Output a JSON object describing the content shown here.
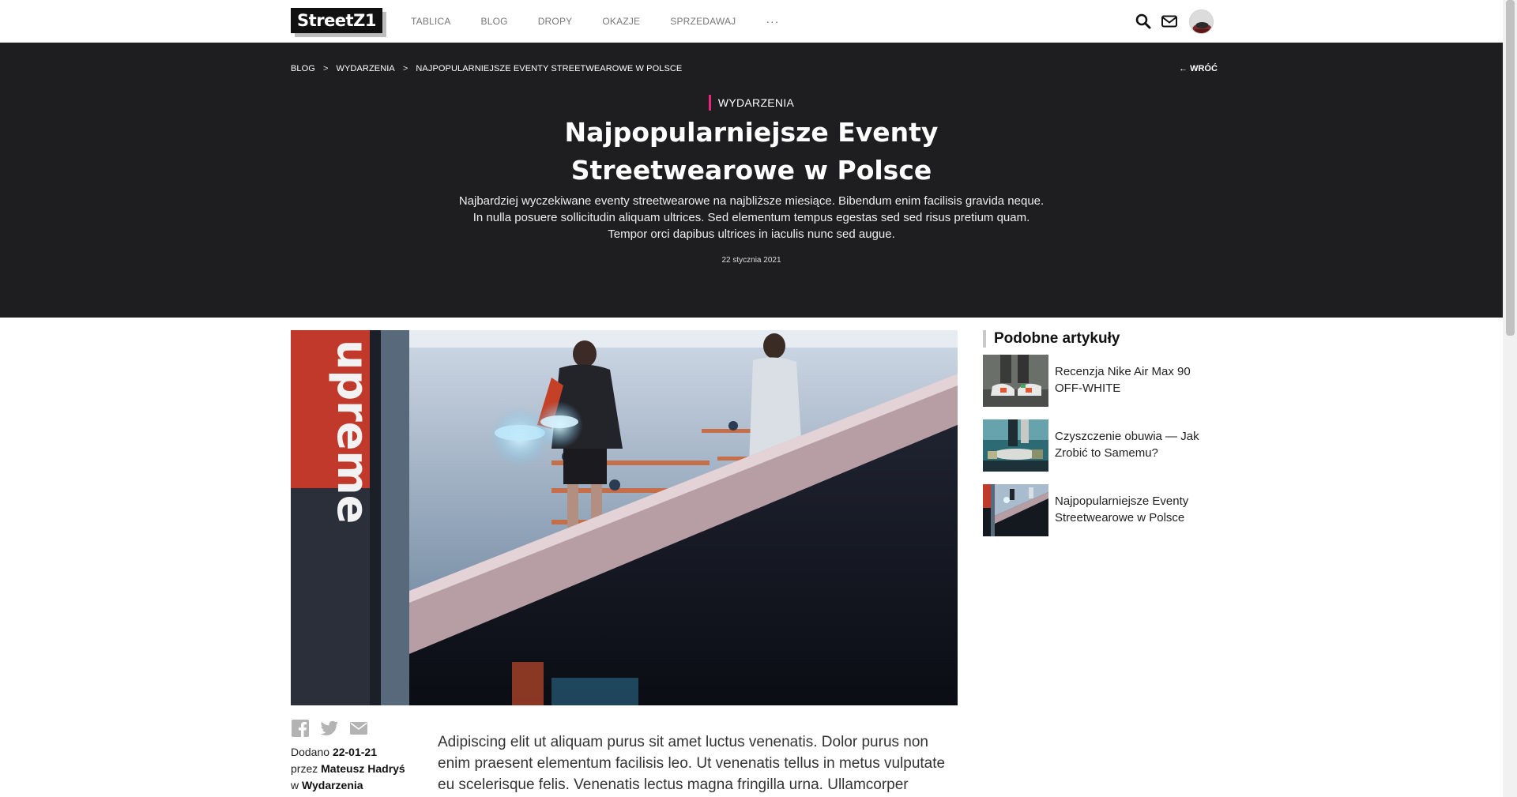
{
  "brand": {
    "logo_text": "StreetZ1"
  },
  "nav": {
    "items": [
      "TABLICA",
      "BLOG",
      "DROPY",
      "OKAZJE",
      "SPRZEDAWAJ"
    ],
    "more": "···"
  },
  "header_icons": [
    "search-icon",
    "mail-icon",
    "user-avatar"
  ],
  "breadcrumb": {
    "items": [
      "BLOG",
      "WYDARZENIA",
      "NAJPOPULARNIEJSZE EVENTY STREETWEAROWE W POLSCE"
    ],
    "separator": ">"
  },
  "back_link": {
    "arrow": "←",
    "label": "WRÓĆ"
  },
  "article": {
    "category": "WYDARZENIA",
    "title": "Najpopularniejsze Eventy Streetwearowe w Polsce",
    "lead": "Najbardziej wyczekiwane eventy streetwearowe na najbliższe miesiące. Bibendum enim facilisis gravida neque. In nulla posuere sollicitudin aliquam ultrices. Sed elementum tempus egestas sed sed risus pretium quam. Tempor orci dapibus ultrices in iaculis nunc sed augue.",
    "date": "22 stycznia 2021",
    "meta": {
      "added_label": "Dodano",
      "added_date": "22-01-21",
      "by_label": "przez",
      "author": "Mateusz Hadryś",
      "in_label": "w",
      "category": "Wydarzenia"
    },
    "body": "Adipiscing elit ut aliquam purus sit amet luctus venenatis. Dolor purus non enim praesent elementum facilisis leo. Ut venenatis tellus in metus vulputate eu scelerisque felis. Venenatis lectus magna fringilla urna. Ullamcorper",
    "image_sign_text": "upreme"
  },
  "share_icons": [
    "facebook-icon",
    "twitter-icon",
    "email-icon"
  ],
  "sidebar": {
    "title": "Podobne artykuły",
    "items": [
      {
        "title": "Recenzja Nike Air Max 90 OFF-WHITE"
      },
      {
        "title": "Czyszczenie obuwia — Jak Zrobić to Samemu?"
      },
      {
        "title": "Najpopularniejsze Eventy Streetwearowe w Polsce"
      }
    ]
  },
  "colors": {
    "accent": "#e3287d",
    "hero_bg": "#1e1e20"
  }
}
